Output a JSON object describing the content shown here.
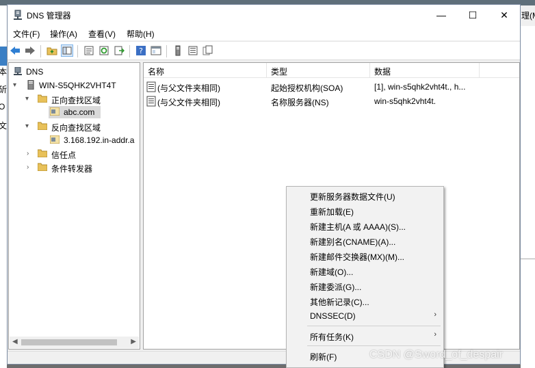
{
  "background": {
    "right_title_fragment": "理(M",
    "left_fragments": [
      "本",
      "斫",
      "O",
      "文"
    ]
  },
  "window": {
    "title": "DNS 管理器",
    "controls": {
      "minimize": "—",
      "maximize": "☐",
      "close": "✕"
    }
  },
  "menubar": [
    "文件(F)",
    "操作(A)",
    "查看(V)",
    "帮助(H)"
  ],
  "toolbar": {
    "icons": [
      "back-icon",
      "forward-icon",
      "up-folder-icon",
      "show-hide-tree-icon",
      "properties-icon",
      "refresh-icon",
      "export-list-icon",
      "help-icon",
      "console-icon",
      "server-icon",
      "list-view-icon",
      "copy-view-icon"
    ]
  },
  "tree": {
    "root": "DNS",
    "server": "WIN-S5QHK2VHT4T",
    "forward_zone": "正向查找区域",
    "forward_child": "abc.com",
    "reverse_zone": "反向查找区域",
    "reverse_child": "3.168.192.in-addr.a",
    "trust_points": "信任点",
    "conditional_forwarders": "条件转发器"
  },
  "list": {
    "columns": [
      "名称",
      "类型",
      "数据"
    ],
    "rows": [
      {
        "name": "(与父文件夹相同)",
        "type": "起始授权机构(SOA)",
        "data": "[1], win-s5qhk2vht4t., h..."
      },
      {
        "name": "(与父文件夹相同)",
        "type": "名称服务器(NS)",
        "data": "win-s5qhk2vht4t."
      }
    ]
  },
  "context_menu": {
    "items": [
      {
        "label": "更新服务器数据文件(U)"
      },
      {
        "label": "重新加载(E)"
      },
      {
        "label": "新建主机(A 或 AAAA)(S)..."
      },
      {
        "label": "新建别名(CNAME)(A)..."
      },
      {
        "label": "新建邮件交换器(MX)(M)..."
      },
      {
        "label": "新建域(O)..."
      },
      {
        "label": "新建委派(G)..."
      },
      {
        "label": "其他新记录(C)..."
      },
      {
        "label": "DNSSEC(D)",
        "submenu_arrow": "›"
      },
      {
        "label": "所有任务(K)",
        "submenu_arrow": "›"
      },
      {
        "label": "刷新(F)"
      }
    ]
  },
  "watermark": "CSDN @Sword_of_despair",
  "colors": {
    "accent": "#3b7fc4",
    "selection": "#d9d9d9",
    "folder": "#e8c15a"
  }
}
